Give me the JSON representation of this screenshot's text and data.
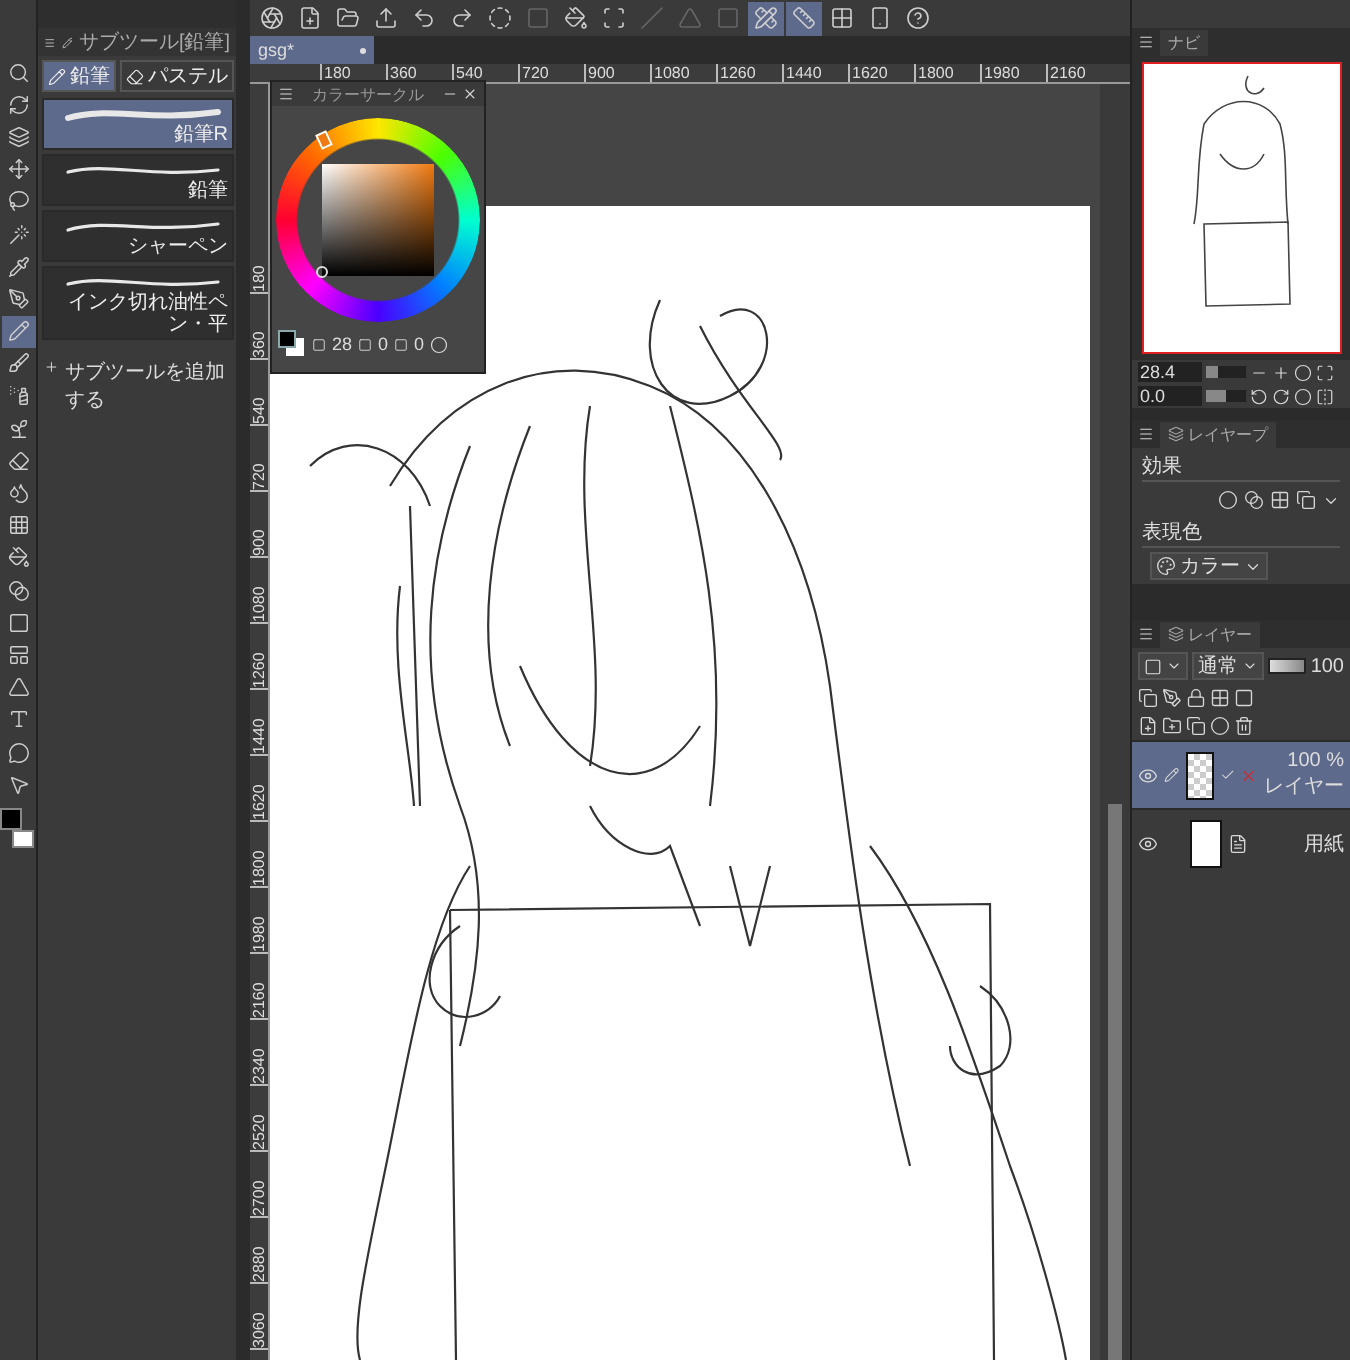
{
  "tool_palette": {
    "tools": [
      {
        "kind": "zoom",
        "selected": false
      },
      {
        "kind": "rotate",
        "selected": false
      },
      {
        "kind": "layer-move",
        "selected": false
      },
      {
        "kind": "move",
        "selected": false
      },
      {
        "kind": "lasso",
        "selected": false
      },
      {
        "kind": "wand",
        "selected": false
      },
      {
        "kind": "eyedropper",
        "selected": false
      },
      {
        "kind": "pen",
        "selected": false
      },
      {
        "kind": "pencil",
        "selected": true
      },
      {
        "kind": "brush",
        "selected": false
      },
      {
        "kind": "airbrush",
        "selected": false
      },
      {
        "kind": "decoration",
        "selected": false
      },
      {
        "kind": "eraser",
        "selected": false
      },
      {
        "kind": "blend",
        "selected": false
      },
      {
        "kind": "grid",
        "selected": false
      },
      {
        "kind": "fill",
        "selected": false
      },
      {
        "kind": "gradient",
        "selected": false
      },
      {
        "kind": "shape",
        "selected": false
      },
      {
        "kind": "frame",
        "selected": false
      },
      {
        "kind": "ruler",
        "selected": false
      },
      {
        "kind": "text",
        "selected": false
      },
      {
        "kind": "balloon",
        "selected": false
      },
      {
        "kind": "correct",
        "selected": false
      }
    ],
    "swatches": [
      {
        "kind": "main",
        "color": "#000000"
      },
      {
        "kind": "sub",
        "color": "#ffffff"
      }
    ]
  },
  "subtool_panel": {
    "title": "サブツール[鉛筆]",
    "groups": [
      {
        "label": "鉛筆",
        "selected": true
      },
      {
        "label": "パステル",
        "selected": false
      }
    ],
    "brushes": [
      {
        "name": "鉛筆R",
        "selected": true
      },
      {
        "name": "鉛筆",
        "selected": false
      },
      {
        "name": "シャーペン",
        "selected": false
      },
      {
        "name": "インク切れ油性ペン・平",
        "selected": false
      }
    ],
    "add_button": "サブツールを追加する"
  },
  "command_bar": {
    "buttons": [
      {
        "kind": "logo",
        "on": false,
        "disabled": false
      },
      {
        "kind": "new",
        "on": false,
        "disabled": false
      },
      {
        "kind": "open",
        "on": false,
        "disabled": false
      },
      {
        "kind": "export",
        "on": false,
        "disabled": false
      },
      {
        "kind": "undo",
        "on": false,
        "disabled": false
      },
      {
        "kind": "redo",
        "on": false,
        "disabled": false
      },
      {
        "kind": "deselect",
        "on": false,
        "disabled": false
      },
      {
        "kind": "clear",
        "on": false,
        "disabled": true
      },
      {
        "kind": "fill",
        "on": false,
        "disabled": false
      },
      {
        "kind": "transform",
        "on": false,
        "disabled": false
      },
      {
        "kind": "snap-line",
        "on": false,
        "disabled": true
      },
      {
        "kind": "snap-half",
        "on": false,
        "disabled": true
      },
      {
        "kind": "snap-square",
        "on": false,
        "disabled": true
      },
      {
        "kind": "snap-ruler",
        "on": true,
        "disabled": false
      },
      {
        "kind": "snap-special",
        "on": true,
        "disabled": false
      },
      {
        "kind": "snap-grid",
        "on": false,
        "disabled": false
      },
      {
        "kind": "mobile",
        "on": false,
        "disabled": false
      },
      {
        "kind": "help",
        "on": false,
        "disabled": false
      }
    ]
  },
  "document_tab": {
    "title": "gsg*",
    "selected": true
  },
  "rulers": {
    "horizontal": [
      "180",
      "360",
      "540",
      "720",
      "900",
      "1080",
      "1260",
      "1440",
      "1620",
      "1800",
      "1980",
      "2160"
    ],
    "vertical": [
      "180",
      "360",
      "540",
      "720",
      "900",
      "1080",
      "1260",
      "1440",
      "1620",
      "1800",
      "1980",
      "2160",
      "2340",
      "2520",
      "2700",
      "2880",
      "3060"
    ]
  },
  "color_circle": {
    "title": "カラーサークル",
    "readouts": [
      "28",
      "0",
      "0"
    ]
  },
  "navigator": {
    "tab": "ナビ",
    "zoom": "28.4",
    "zoom_slider": {
      "level": 0.3
    },
    "rotation": "0.0",
    "rotation_slider": {
      "level": 0.5
    }
  },
  "layer_property": {
    "tab": "レイヤープ",
    "effect_label": "効果",
    "expression_label": "表現色",
    "expression_value": "カラー"
  },
  "layer_panel": {
    "tab": "レイヤー",
    "blend_mode": "通常",
    "opacity": "100",
    "opacity_slider": {
      "level": 1
    },
    "layers": [
      {
        "kind": "raster",
        "name": "レイヤー",
        "opacity": "100 %",
        "selected": true,
        "visible": true
      },
      {
        "kind": "paper",
        "name": "用紙",
        "selected": false,
        "visible": true
      }
    ]
  }
}
